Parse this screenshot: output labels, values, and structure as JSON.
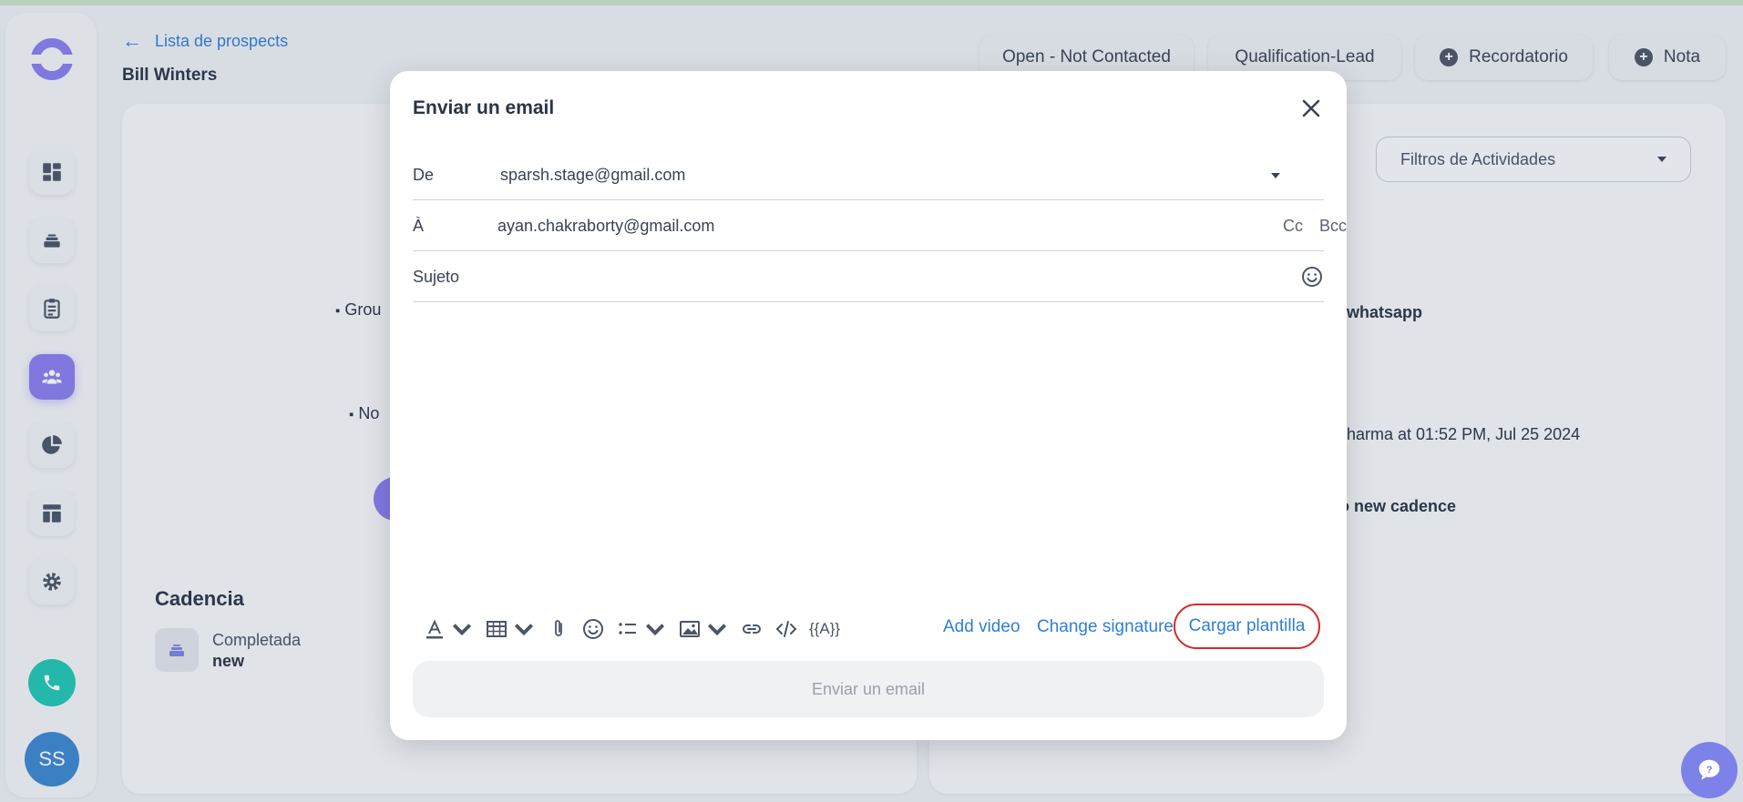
{
  "header": {
    "back_link": "Lista de prospects",
    "prospect_name": "Bill Winters",
    "status_pill": "Open - Not Contacted",
    "stage_pill": "Qualification-Lead",
    "reminder_button": "Recordatorio",
    "note_button": "Nota"
  },
  "sidebar": {
    "items": [
      "dashboard-icon",
      "cadence-icon",
      "tasks-icon",
      "prospects-icon",
      "reports-icon",
      "templates-icon",
      "settings-icon"
    ],
    "active_item": "prospects-icon",
    "avatar_initials": "SS"
  },
  "background": {
    "left_fragments": {
      "group": "Grou",
      "notes": "No"
    },
    "right_fragments": {
      "whatsapp": "whatsapp",
      "activity": "harma at 01:52 PM, Jul 25 2024",
      "cadence": "o new cadence"
    },
    "filter_placeholder": "Filtros de Actividades",
    "cadencia_title": "Cadencia",
    "cadencia_status": "Completada",
    "cadencia_name": "new"
  },
  "modal": {
    "title": "Enviar un email",
    "from_label": "De",
    "from_value": "sparsh.stage@gmail.com",
    "to_label": "À",
    "to_value": "ayan.chakraborty@gmail.com",
    "cc_label": "Cc",
    "bcc_label": "Bcc",
    "subject_label": "Sujeto",
    "subject_value": "",
    "toolbar_vars": "{{A}}",
    "add_video": "Add video",
    "change_signature": "Change signature",
    "load_template": "Cargar plantilla",
    "send_button": "Enviar un email"
  },
  "colors": {
    "accent": "#2f7fd4",
    "active_nav": "#8a7df0",
    "phone": "#20c6b3",
    "highlight": "#d62a2a"
  }
}
